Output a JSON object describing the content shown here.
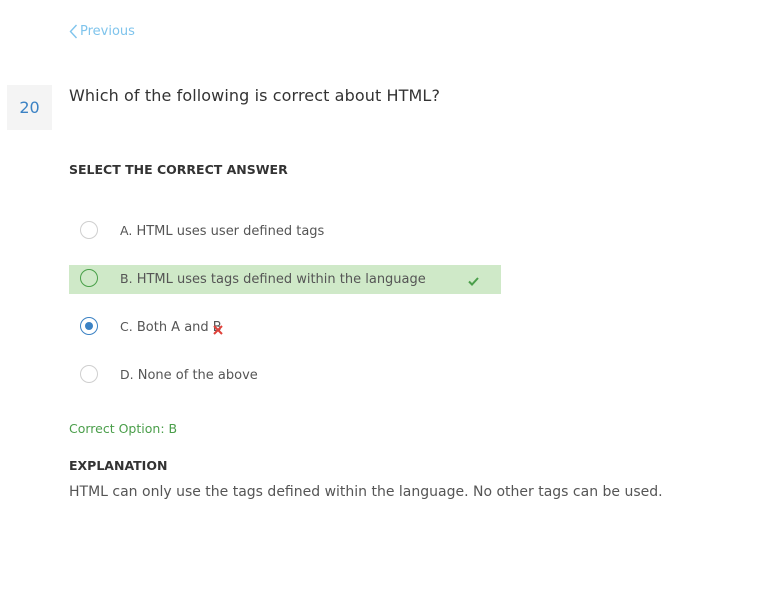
{
  "nav": {
    "previous_label": "Previous"
  },
  "question": {
    "number": "20",
    "text": "Which of the following is correct about HTML?"
  },
  "section_label": "SELECT THE CORRECT ANSWER",
  "options": [
    {
      "letter": "A.",
      "text": "HTML uses user defined tags",
      "state": "unselected"
    },
    {
      "letter": "B.",
      "text": "HTML uses tags defined within the language",
      "state": "correct"
    },
    {
      "letter": "C.",
      "text": "Both A and B",
      "state": "selected-wrong"
    },
    {
      "letter": "D.",
      "text": "None of the above",
      "state": "unselected"
    }
  ],
  "result": {
    "correct_option": "Correct Option: B"
  },
  "explanation": {
    "label": "EXPLANATION",
    "text": "HTML can only use the tags defined within the language. No other tags can be used."
  },
  "icons": {
    "previous": "chevron-left-icon",
    "correct": "checkmark-icon",
    "wrong": "cross-icon"
  },
  "colors": {
    "link": "#7fc4ec",
    "accent_blue": "#3b82c4",
    "correct_green": "#4a9e4a",
    "correct_bg": "#cfe9c8",
    "wrong_red": "#e0413a"
  }
}
